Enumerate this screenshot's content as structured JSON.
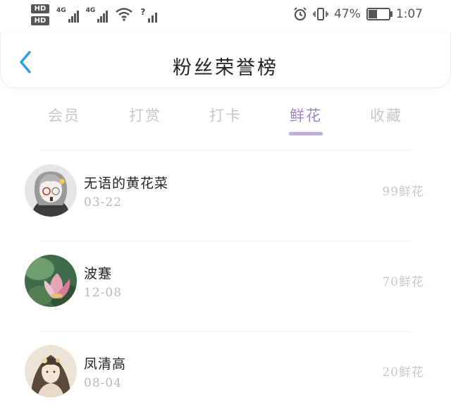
{
  "status_bar": {
    "hd_labels": [
      "HD",
      "HD"
    ],
    "network_labels": [
      "4G",
      "4G"
    ],
    "wifi_icon": "wifi-icon",
    "alarm_icon": "alarm-icon",
    "vibrate_icon": "vibrate-icon",
    "battery_percent": "47%",
    "battery_level": 0.47,
    "time": "1:07"
  },
  "header": {
    "back_icon": "chevron-left-icon",
    "title": "粉丝荣誉榜",
    "accent_color": "#2b9ae8"
  },
  "tabs": {
    "items": [
      {
        "label": "会员"
      },
      {
        "label": "打赏"
      },
      {
        "label": "打卡"
      },
      {
        "label": "鲜花"
      },
      {
        "label": "收藏"
      }
    ],
    "active_index": 3,
    "active_color": "#9b86c6"
  },
  "fans": [
    {
      "name": "无语的黄花菜",
      "date": "03-22",
      "count": "99鲜花",
      "avatar": "anime-girl-glasses-avatar"
    },
    {
      "name": "波蹇",
      "date": "12-08",
      "count": "70鲜花",
      "avatar": "lotus-flower-avatar"
    },
    {
      "name": "凤清高",
      "date": "08-04",
      "count": "20鲜花",
      "avatar": "ancient-style-girl-avatar"
    }
  ]
}
